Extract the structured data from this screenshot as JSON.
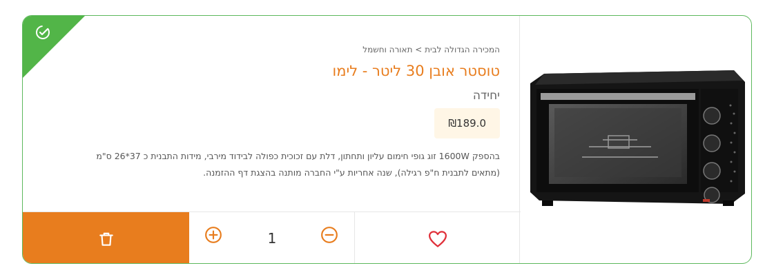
{
  "product": {
    "breadcrumb": "המכירה הגדולה לבית > תאורה וחשמל",
    "title": "טוסטר אובן 30 ליטר - לימו",
    "unit": "יחידה",
    "price": "₪189.0",
    "description": "בהספק 1600W זוג גופי חימום עליון ותחתון, דלת עם זכוכית כפולה לבידוד מירבי, מידות התבנית כ 37*26 ס\"מ (מתאים לתבנית ח\"פ רגילה), שנה אחריות ע\"י החברה מותנה בהצגת דף ההזמנה."
  },
  "cart": {
    "quantity": "1"
  },
  "icons": {
    "ribbon": "check-circle-icon",
    "delete": "trash-icon",
    "plus": "plus-circle-icon",
    "minus": "minus-circle-icon",
    "favorite": "heart-icon",
    "image": "toaster-oven-image"
  },
  "colors": {
    "accent": "#e87d1e",
    "ribbon": "#52b548",
    "border": "#5cb85c",
    "price_bg": "#fff6e6"
  }
}
